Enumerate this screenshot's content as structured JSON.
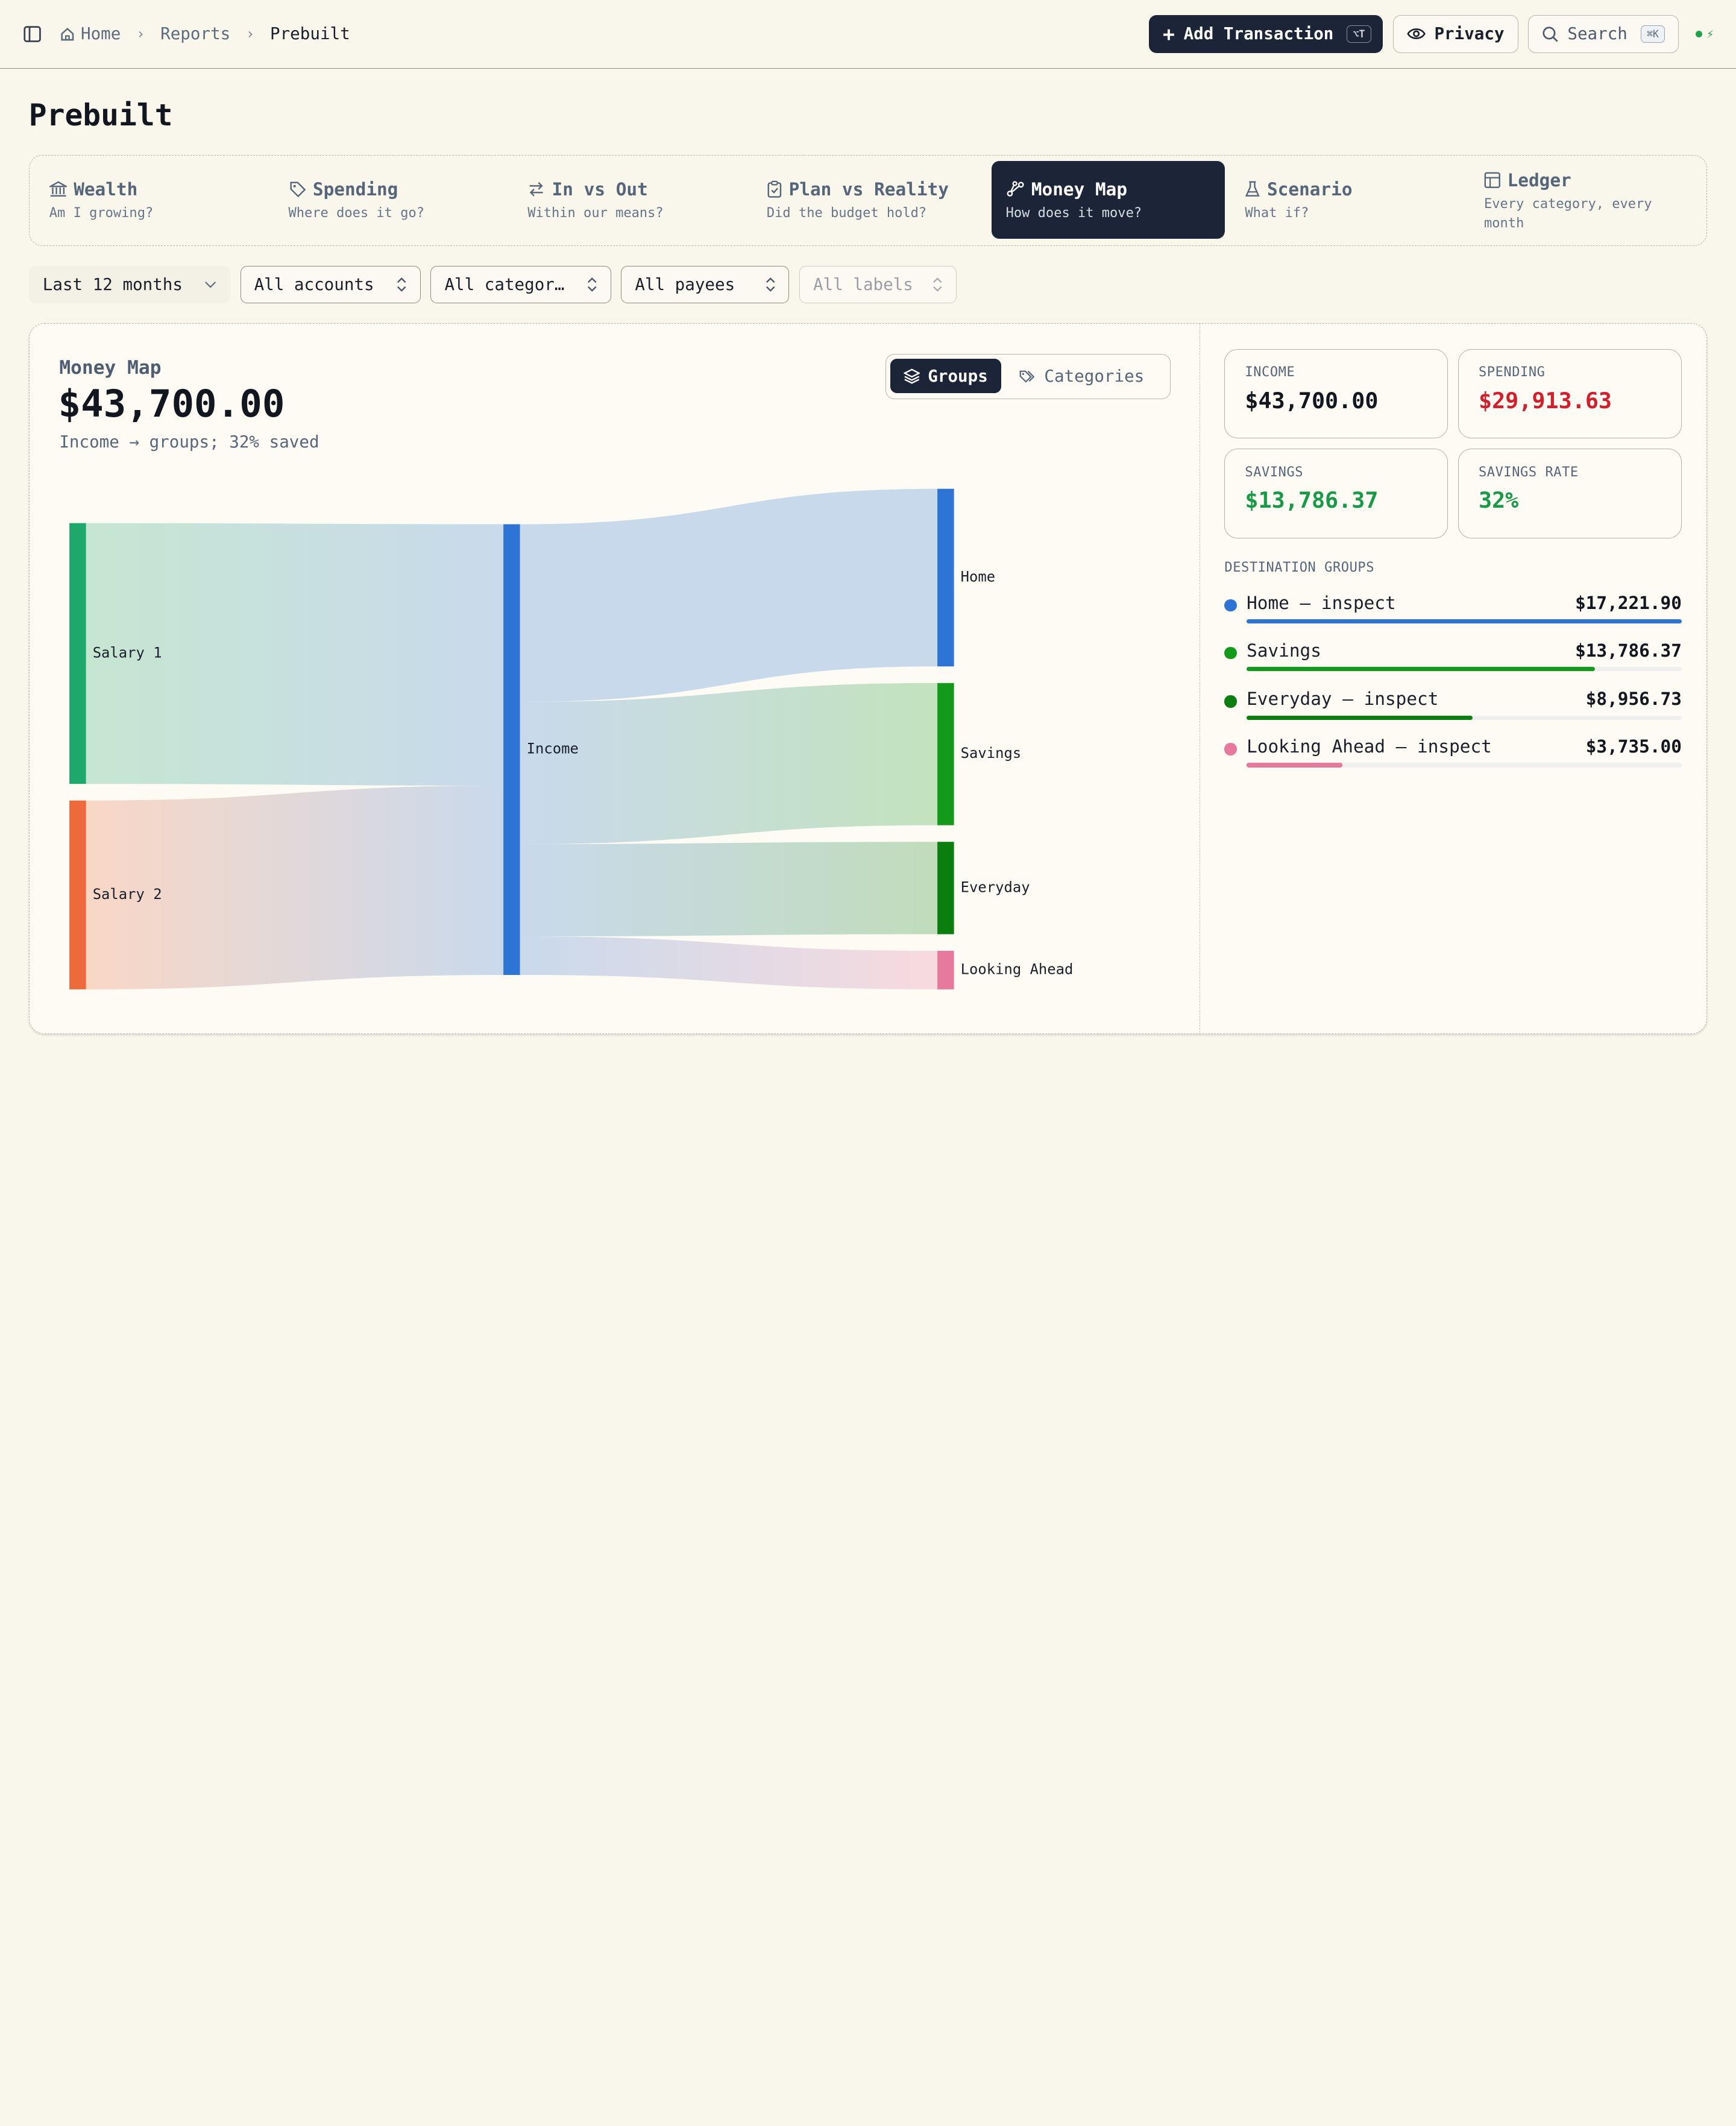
{
  "header": {
    "breadcrumb": [
      "Home",
      "Reports",
      "Prebuilt"
    ],
    "add_label": "Add Transaction",
    "add_shortcut": "⌥T",
    "privacy_label": "Privacy",
    "search_label": "Search",
    "search_shortcut": "⌘K",
    "status_glyph": "⚡"
  },
  "page": {
    "title": "Prebuilt"
  },
  "tabs": [
    {
      "title": "Wealth",
      "subtitle": "Am I growing?",
      "icon": "bank-icon"
    },
    {
      "title": "Spending",
      "subtitle": "Where does it go?",
      "icon": "tag-icon"
    },
    {
      "title": "In vs Out",
      "subtitle": "Within our means?",
      "icon": "arrows-icon"
    },
    {
      "title": "Plan vs Reality",
      "subtitle": "Did the budget hold?",
      "icon": "clipboard-icon"
    },
    {
      "title": "Money Map",
      "subtitle": "How does it move?",
      "icon": "flow-icon",
      "active": true
    },
    {
      "title": "Scenario",
      "subtitle": "What if?",
      "icon": "flask-icon"
    },
    {
      "title": "Ledger",
      "subtitle": "Every category, every month",
      "icon": "table-icon"
    }
  ],
  "filters": {
    "period": "Last 12 months",
    "accounts": "All accounts",
    "categories": "All categor…",
    "payees": "All payees",
    "labels": "All labels"
  },
  "money_map": {
    "label": "Money Map",
    "total": "$43,700.00",
    "subtitle": "Income → groups; 32% saved",
    "view_groups": "Groups",
    "view_categories": "Categories"
  },
  "chart_data": {
    "type": "sankey",
    "sources": [
      {
        "name": "Salary 1",
        "share": 0.58,
        "color": "#1fa86b"
      },
      {
        "name": "Salary 2",
        "share": 0.42,
        "color": "#ee6a3a"
      }
    ],
    "middle": {
      "name": "Income",
      "color": "#2d74d4"
    },
    "targets": [
      {
        "name": "Home",
        "value": 17221.9,
        "color": "#2d74d4"
      },
      {
        "name": "Savings",
        "value": 13786.37,
        "color": "#139a1a"
      },
      {
        "name": "Everyday",
        "value": 8956.73,
        "color": "#0a7e0e"
      },
      {
        "name": "Looking Ahead",
        "value": 3735.0,
        "color": "#e8799e"
      }
    ]
  },
  "stats": {
    "income_label": "INCOME",
    "income_value": "$43,700.00",
    "spending_label": "SPENDING",
    "spending_value": "$29,913.63",
    "savings_label": "SAVINGS",
    "savings_value": "$13,786.37",
    "rate_label": "SAVINGS RATE",
    "rate_value": "32%"
  },
  "destinations": {
    "title": "DESTINATION GROUPS",
    "items": [
      {
        "name": "Home — inspect",
        "amount": "$17,221.90",
        "fraction": 1.0,
        "color": "#2d74d4"
      },
      {
        "name": "Savings",
        "amount": "$13,786.37",
        "fraction": 0.8,
        "color": "#139a1a"
      },
      {
        "name": "Everyday — inspect",
        "amount": "$8,956.73",
        "fraction": 0.52,
        "color": "#0a7e0e"
      },
      {
        "name": "Looking Ahead — inspect",
        "amount": "$3,735.00",
        "fraction": 0.22,
        "color": "#e8799e"
      }
    ]
  },
  "colors": {
    "accent_dark": "#1c2538",
    "background": "#f9f6ec",
    "spending_red": "#d1202c",
    "savings_green": "#1a9a48"
  }
}
